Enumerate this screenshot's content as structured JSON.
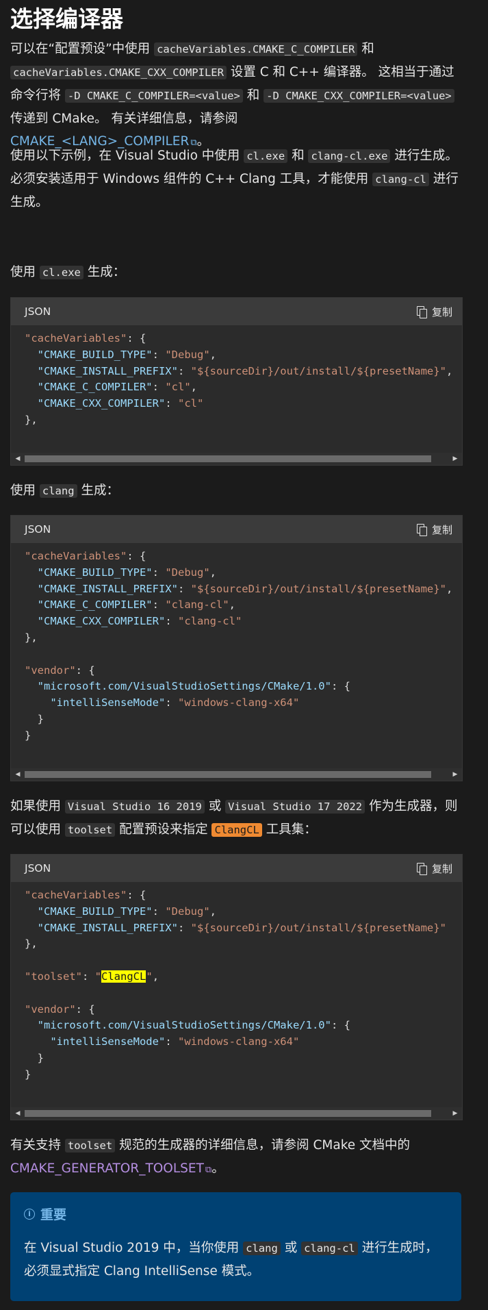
{
  "title": "选择编译器",
  "para1": {
    "t1": "可以在“配置预设”中使用 ",
    "c1": "cacheVariables.CMAKE_C_COMPILER",
    "t2": " 和",
    "c2": "cacheVariables.CMAKE_CXX_COMPILER",
    "t3": " 设置 C 和 C++ 编译器。 这相当于通过命令行将 ",
    "c3": "-D CMAKE_C_COMPILER=<value>",
    "t4": " 和 ",
    "c4": "-D CMAKE_CXX_COMPILER=<value>",
    "t5": " 传递到 CMake。 有关详细信息，请参阅",
    "link": "CMAKE_<LANG>_COMPILER",
    "t6": "。"
  },
  "para2": {
    "t1": "使用以下示例，在 Visual Studio 中使用 ",
    "c1": "cl.exe",
    "t2": " 和 ",
    "c2": "clang-cl.exe",
    "t3": " 进行生成。 必须安装适用于 Windows 组件的 C++ Clang 工具，才能使用 ",
    "c3": "clang-cl",
    "t4": " 进行生成。"
  },
  "para3": {
    "t1": "使用 ",
    "c1": "cl.exe",
    "t2": " 生成："
  },
  "para4": {
    "t1": "使用 ",
    "c1": "clang",
    "t2": " 生成："
  },
  "para5": {
    "t1": "如果使用 ",
    "c1": "Visual Studio 16 2019",
    "t2": " 或 ",
    "c2": "Visual Studio 17 2022",
    "t3": " 作为生成器，则可以使用 ",
    "c3": "toolset",
    "t4": " 配置预设来指定 ",
    "c4": "ClangCL",
    "t5": " 工具集："
  },
  "para6": {
    "t1": "有关支持 ",
    "c1": "toolset",
    "t2": " 规范的生成器的详细信息，请参阅 CMake 文档中的",
    "link": "CMAKE_GENERATOR_TOOLSET",
    "t3": "。"
  },
  "code_common": {
    "lang": "JSON",
    "copy_label": "复制"
  },
  "code1": {
    "l1_key": "\"cacheVariables\"",
    "l2_k": "\"CMAKE_BUILD_TYPE\"",
    "l2_v": "\"Debug\"",
    "l3_k": "\"CMAKE_INSTALL_PREFIX\"",
    "l3_v": "\"${sourceDir}/out/install/${presetName}\"",
    "l4_k": "\"CMAKE_C_COMPILER\"",
    "l4_v": "\"cl\"",
    "l5_k": "\"CMAKE_CXX_COMPILER\"",
    "l5_v": "\"cl\""
  },
  "code2": {
    "l1_key": "\"cacheVariables\"",
    "l2_k": "\"CMAKE_BUILD_TYPE\"",
    "l2_v": "\"Debug\"",
    "l3_k": "\"CMAKE_INSTALL_PREFIX\"",
    "l3_v": "\"${sourceDir}/out/install/${presetName}\"",
    "l4_k": "\"CMAKE_C_COMPILER\"",
    "l4_v": "\"clang-cl\"",
    "l5_k": "\"CMAKE_CXX_COMPILER\"",
    "l5_v": "\"clang-cl\"",
    "vendor_key": "\"vendor\"",
    "ms_key": "\"microsoft.com/VisualStudioSettings/CMake/1.0\"",
    "isense_k": "\"intelliSenseMode\"",
    "isense_v": "\"windows-clang-x64\""
  },
  "code3": {
    "l1_key": "\"cacheVariables\"",
    "l2_k": "\"CMAKE_BUILD_TYPE\"",
    "l2_v": "\"Debug\"",
    "l3_k": "\"CMAKE_INSTALL_PREFIX\"",
    "l3_v": "\"${sourceDir}/out/install/${presetName}\"",
    "toolset_key": "\"toolset\"",
    "toolset_q": "\"",
    "toolset_val": "ClangCL",
    "vendor_key": "\"vendor\"",
    "ms_key": "\"microsoft.com/VisualStudioSettings/CMake/1.0\"",
    "isense_k": "\"intelliSenseMode\"",
    "isense_v": "\"windows-clang-x64\""
  },
  "scrollbar": {
    "thumb_fraction": 0.96,
    "thumb_position": 0
  },
  "alert": {
    "title": "重要",
    "t1": "在 Visual Studio 2019 中，当你使用 ",
    "c1": "clang",
    "t2": " 或 ",
    "c2": "clang-cl",
    "t3": " 进行生成时，必须显式指定 Clang IntelliSense 模式。"
  },
  "colors": {
    "background": "#1b1b1b",
    "link": "#75b6e7",
    "visited_link": "#b48ee0",
    "alert_bg": "#004173",
    "highlight": "#ffff00",
    "highlight_orange": "#ef8a32"
  },
  "icons": {
    "copy": "copy-icon",
    "external": "external-link-icon",
    "info": "info-icon"
  }
}
